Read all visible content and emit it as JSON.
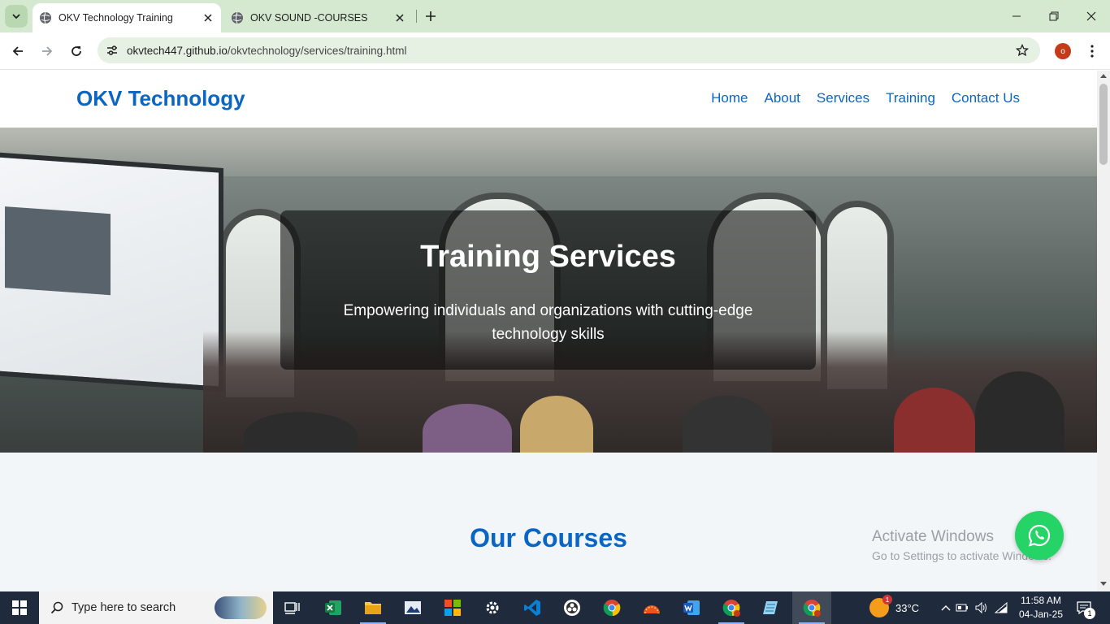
{
  "browser": {
    "tabs": [
      {
        "title": "OKV Technology Training",
        "active": true
      },
      {
        "title": "OKV SOUND -COURSES",
        "active": false
      }
    ],
    "url_host": "okvtech447.github.io",
    "url_path": "/okvtechnology/services/training.html",
    "profile_initial": "o",
    "colors": {
      "tabbar": "#d4e9cf",
      "omnibox": "#e6f0e3"
    }
  },
  "site": {
    "brand": "OKV Technology",
    "nav": [
      "Home",
      "About",
      "Services",
      "Training",
      "Contact Us"
    ],
    "hero": {
      "title": "Training Services",
      "subtitle": "Empowering individuals and organizations with cutting-edge technology skills"
    },
    "courses_title": "Our Courses",
    "colors": {
      "primary": "#0b66c3",
      "whatsapp": "#25d366"
    }
  },
  "watermark": {
    "line1": "Activate Windows",
    "line2": "Go to Settings to activate Windows."
  },
  "taskbar": {
    "search_placeholder": "Type here to search",
    "weather": "33°C",
    "weather_badge": "1",
    "time": "11:58 AM",
    "date": "04-Jan-25",
    "notification_count": "1",
    "apps": [
      "task-view-icon",
      "excel-icon",
      "file-explorer-icon",
      "photo-viewer-icon",
      "store-icon",
      "settings-icon",
      "vscode-icon",
      "obs-icon",
      "chrome-icon",
      "ubuntu-icon",
      "word-icon",
      "chrome-profile-icon",
      "notepad-icon",
      "chrome-active-icon"
    ]
  }
}
